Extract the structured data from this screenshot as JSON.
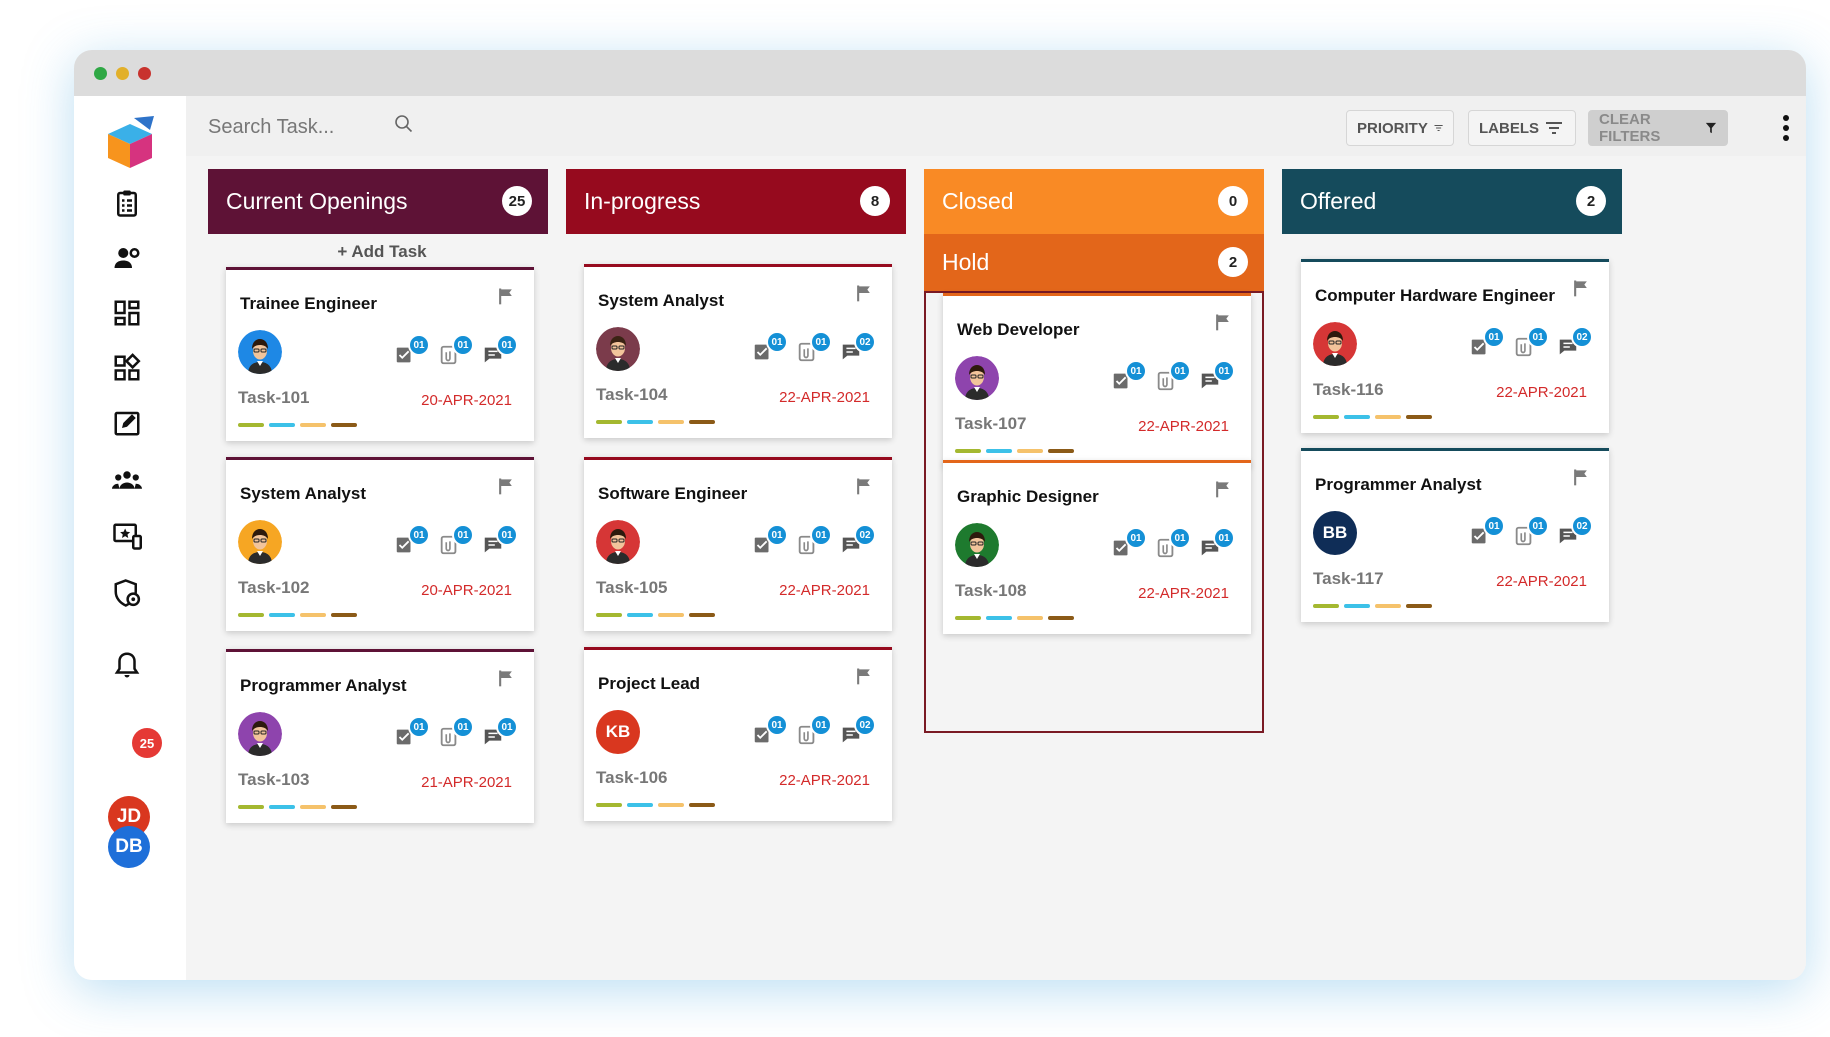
{
  "search": {
    "placeholder": "Search Task..."
  },
  "filters": {
    "priority": "PRIORITY",
    "labels": "LABELS",
    "clear": "CLEAR FILTERS"
  },
  "notifications": {
    "count": "25"
  },
  "users": [
    {
      "initials": "JD",
      "color": "#d9371f"
    },
    {
      "initials": "DB",
      "color": "#1e6fd9"
    }
  ],
  "add_task_label": "+ Add Task",
  "label_colors": [
    "#a4b830",
    "#3cc1e8",
    "#f5c26b",
    "#8b5a17"
  ],
  "columns": {
    "openings": {
      "title": "Current Openings",
      "count": "25",
      "color": "#5e1236"
    },
    "progress": {
      "title": "In-progress",
      "count": "8",
      "color": "#960a1e"
    },
    "closed": {
      "title": "Closed",
      "count": "0",
      "color": "#f98a25"
    },
    "hold": {
      "title": "Hold",
      "count": "2",
      "color": "#e3661a"
    },
    "offered": {
      "title": "Offered",
      "count": "2",
      "color": "#154b5c"
    }
  },
  "cards": {
    "c101": {
      "title": "Trainee Engineer",
      "id": "Task-101",
      "due": "20-APR-2021",
      "checks": "01",
      "attachments": "01",
      "comments": "01"
    },
    "c102": {
      "title": "System Analyst",
      "id": "Task-102",
      "due": "20-APR-2021",
      "checks": "01",
      "attachments": "01",
      "comments": "01"
    },
    "c103": {
      "title": "Programmer Analyst",
      "id": "Task-103",
      "due": "21-APR-2021",
      "checks": "01",
      "attachments": "01",
      "comments": "01"
    },
    "c104": {
      "title": "System Analyst",
      "id": "Task-104",
      "due": "22-APR-2021",
      "checks": "01",
      "attachments": "01",
      "comments": "02"
    },
    "c105": {
      "title": "Software Engineer",
      "id": "Task-105",
      "due": "22-APR-2021",
      "checks": "01",
      "attachments": "01",
      "comments": "02"
    },
    "c106": {
      "title": "Project Lead",
      "id": "Task-106",
      "due": "22-APR-2021",
      "checks": "01",
      "attachments": "01",
      "comments": "02",
      "avatar_initials": "KB"
    },
    "c107": {
      "title": "Web Developer",
      "id": "Task-107",
      "due": "22-APR-2021",
      "checks": "01",
      "attachments": "01",
      "comments": "01"
    },
    "c108": {
      "title": "Graphic Designer",
      "id": "Task-108",
      "due": "22-APR-2021",
      "checks": "01",
      "attachments": "01",
      "comments": "01"
    },
    "c116": {
      "title": "Computer Hardware Engineer",
      "id": "Task-116",
      "due": "22-APR-2021",
      "checks": "01",
      "attachments": "01",
      "comments": "02"
    },
    "c117": {
      "title": "Programmer Analyst",
      "id": "Task-117",
      "due": "22-APR-2021",
      "checks": "01",
      "attachments": "01",
      "comments": "02",
      "avatar_initials": "BB"
    }
  }
}
